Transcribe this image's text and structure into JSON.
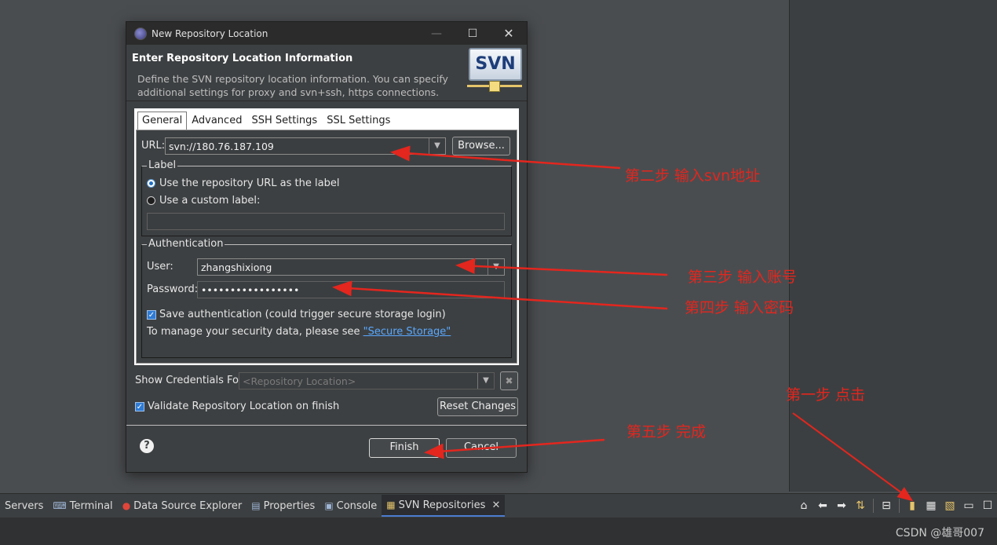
{
  "dialog": {
    "title": "New Repository Location",
    "banner_heading": "Enter Repository Location Information",
    "banner_description": "Define the SVN repository location information. You can specify additional settings for proxy and svn+ssh, https connections.",
    "logo_text": "SVN",
    "window_controls": {
      "minimize": "—",
      "maximize": "☐",
      "close": "✕"
    }
  },
  "tabs": [
    "General",
    "Advanced",
    "SSH Settings",
    "SSL Settings"
  ],
  "url": {
    "label": "URL:",
    "value": "svn://180.76.187.109",
    "browse_label": "Browse..."
  },
  "label_group": {
    "title": "Label",
    "option_repo_url": "Use the repository URL as the label",
    "option_custom": "Use a custom label:",
    "custom_value": "",
    "selected": "repo_url"
  },
  "auth_group": {
    "title": "Authentication",
    "user_label": "User:",
    "user_value": "zhangshixiong",
    "password_label": "Password:",
    "password_value": "•••••••••••••••••",
    "save_auth_label": "Save authentication (could trigger secure storage login)",
    "save_auth_checked": true,
    "manage_text": "To manage your security data, please see ",
    "manage_link": "\"Secure Storage\""
  },
  "credentials": {
    "label": "Show Credentials For:",
    "placeholder": "<Repository Location>"
  },
  "validate": {
    "label": "Validate Repository Location on finish",
    "checked": true,
    "reset_label": "Reset Changes"
  },
  "footer": {
    "help": "?",
    "finish_label": "Finish",
    "cancel_label": "Cancel"
  },
  "bottom_tabs": [
    {
      "label": "Servers"
    },
    {
      "label": "Terminal"
    },
    {
      "label": "Data Source Explorer"
    },
    {
      "label": "Properties"
    },
    {
      "label": "Console"
    },
    {
      "label": "SVN Repositories",
      "active": true
    }
  ],
  "annotations": {
    "step1": "第一步 点击",
    "step2": "第二步 输入svn地址",
    "step3": "第三步 输入账号",
    "step4": "第四步 输入密码",
    "step5": "第五步 完成",
    "color": "#e3261e"
  },
  "watermark": "CSDN @雄哥007",
  "colors": {
    "background": "#4a4d50",
    "dialog": "#3d4042",
    "accent": "#2f7bd4",
    "link": "#59a8ff"
  }
}
